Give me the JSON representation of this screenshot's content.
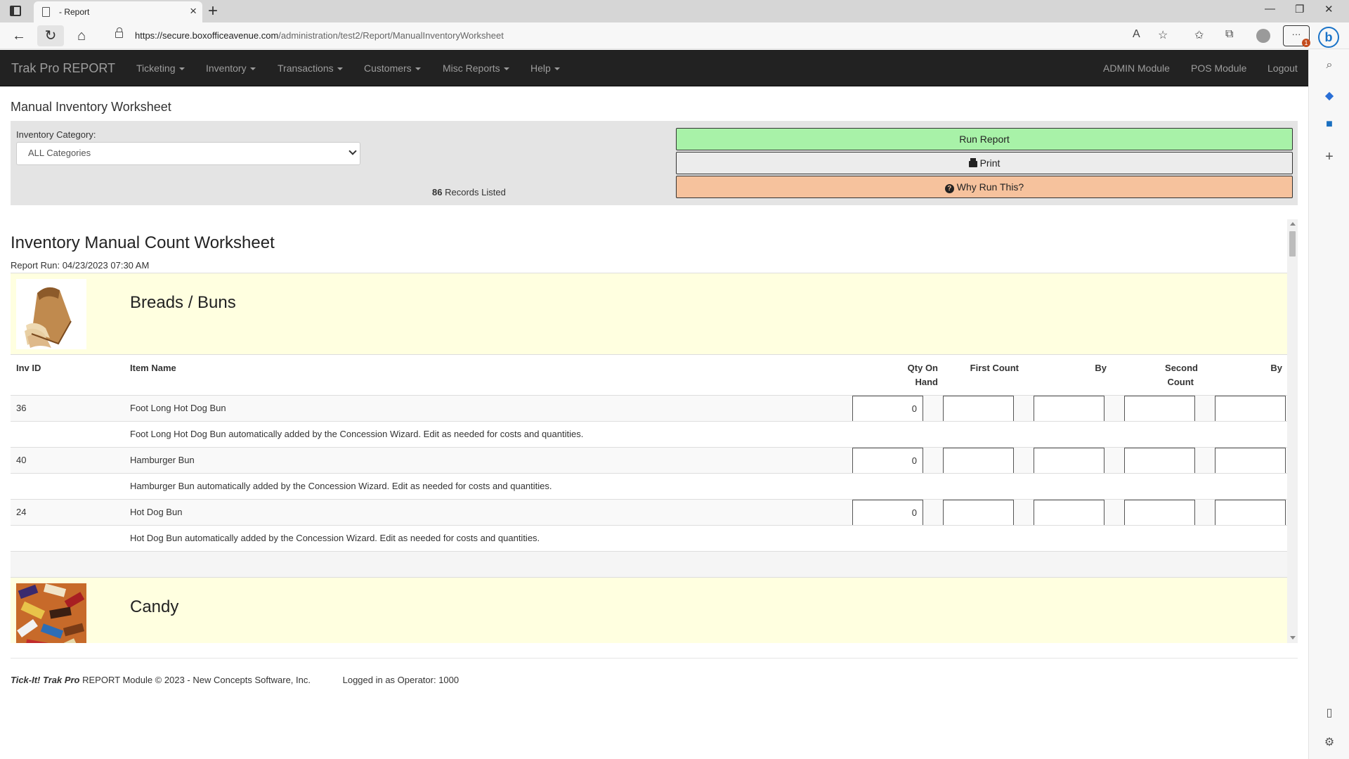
{
  "browser": {
    "tab_title": "- Report",
    "url_host": "https://secure.boxofficeavenue.com",
    "url_path": "/administration/test2/Report/ManualInventoryWorksheet",
    "ext_badge": "1"
  },
  "nav": {
    "brand": "Trak Pro REPORT",
    "menus": [
      "Ticketing",
      "Inventory",
      "Transactions",
      "Customers",
      "Misc Reports",
      "Help"
    ],
    "right": [
      "ADMIN Module",
      "POS Module",
      "Logout"
    ]
  },
  "page": {
    "title": "Manual Inventory Worksheet",
    "filter_label": "Inventory Category:",
    "filter_value": "ALL Categories",
    "records_count": "86",
    "records_text": "Records Listed",
    "run_label": "Run Report",
    "print_label": "Print",
    "why_label": "Why Run This?"
  },
  "report": {
    "title": "Inventory Manual Count Worksheet",
    "run_text": "Report Run: 04/23/2023 07:30 AM",
    "columns": {
      "inv_id": "Inv ID",
      "item_name": "Item Name",
      "qty_line1": "Qty On",
      "qty_line2": "Hand",
      "first_count": "First Count",
      "by1": "By",
      "second_line1": "Second",
      "second_line2": "Count",
      "by2": "By"
    },
    "categories": [
      {
        "name": "Breads / Buns",
        "image": "bread-loaf",
        "items": [
          {
            "id": "36",
            "name": "Foot Long Hot Dog Bun",
            "qty": "0",
            "desc": "Foot Long Hot Dog Bun automatically added by the Concession Wizard. Edit as needed for costs and quantities."
          },
          {
            "id": "40",
            "name": "Hamburger Bun",
            "qty": "0",
            "desc": "Hamburger Bun automatically added by the Concession Wizard. Edit as needed for costs and quantities."
          },
          {
            "id": "24",
            "name": "Hot Dog Bun",
            "qty": "0",
            "desc": "Hot Dog Bun automatically added by the Concession Wizard. Edit as needed for costs and quantities."
          }
        ]
      },
      {
        "name": "Candy",
        "image": "candy-pile",
        "items": []
      }
    ]
  },
  "footer": {
    "brand": "Tick-It! Trak Pro",
    "text": "REPORT Module © 2023 - New Concepts Software, Inc.",
    "operator": "Logged in as Operator: 1000"
  },
  "colors": {
    "navbar": "#222222",
    "run_button": "#a8f2a8",
    "why_button": "#f6c29d",
    "category_band": "#ffffe0"
  }
}
